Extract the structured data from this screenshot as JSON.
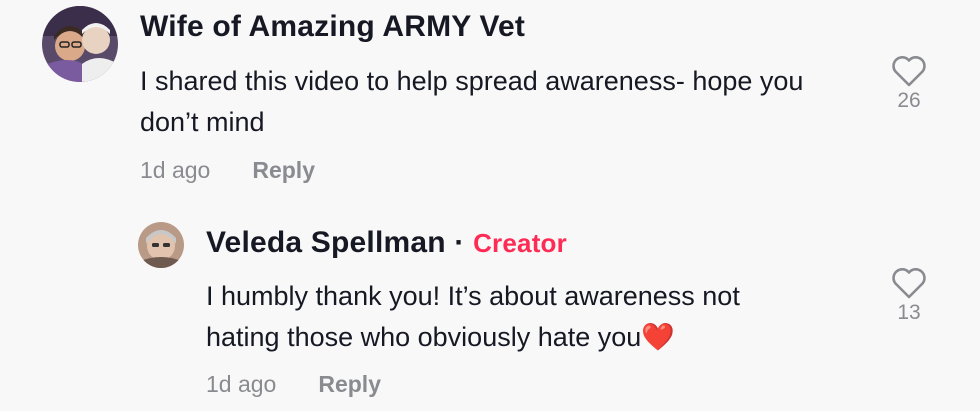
{
  "comments": [
    {
      "author": "Wife of Amazing ARMY Vet",
      "text": "I shared this video to help spread awareness- hope you\ndon’t mind",
      "time": "1d ago",
      "reply_label": "Reply",
      "likes": "26",
      "icons": {
        "like": "heart-outline-icon",
        "avatar": "user-photo-avatar"
      }
    },
    {
      "author": "Veleda Spellman",
      "separator": "·",
      "badge": "Creator",
      "text": "I humbly thank you! It’s about awareness not\nhating those who obviously hate you❤️",
      "time": "1d ago",
      "reply_label": "Reply",
      "likes": "13",
      "icons": {
        "like": "heart-outline-icon",
        "avatar": "user-photo-avatar"
      }
    }
  ],
  "colors": {
    "background": "#f8f8f8",
    "text": "#161823",
    "muted": "#8a8b91",
    "creator_badge": "#fe2c55"
  }
}
